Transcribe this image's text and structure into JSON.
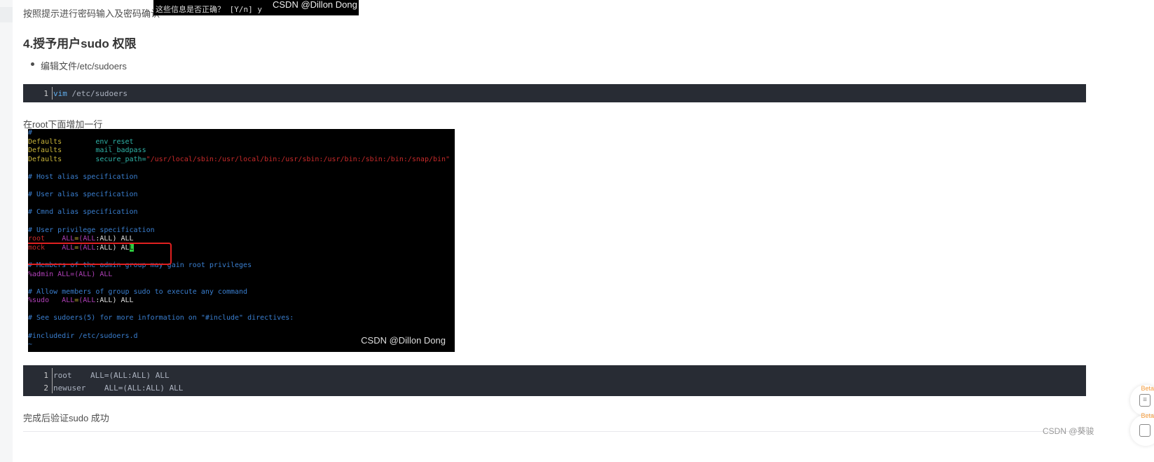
{
  "intro_text": "按照提示进行密码输入及密码确认",
  "top_image": {
    "line1": "这些信息是否正确？ [Y/n] y",
    "watermark": "CSDN @Dillon Dong"
  },
  "heading": "4.授予用户sudo 权限",
  "bullet": "编辑文件/etc/sudoers",
  "code1": {
    "lines": [
      {
        "n": "1",
        "kw": "vim",
        "rest": " /etc/sudoers"
      }
    ]
  },
  "para_root": "在root下面增加一行",
  "terminal": {
    "watermark": "CSDN @Dillon Dong",
    "hash": "#",
    "d1": [
      "Defaults",
      "env_reset"
    ],
    "d2": [
      "Defaults",
      "mail_badpass"
    ],
    "d3": [
      "Defaults",
      "secure_path=",
      "\"/usr/local/sbin:/usr/local/bin:/usr/sbin:/usr/bin:/sbin:/bin:/snap/bin\""
    ],
    "c_host": "# Host alias specification",
    "c_user": "# User alias specification",
    "c_cmnd": "# Cmnd alias specification",
    "c_priv": "# User privilege specification",
    "root_user": "root",
    "mock_user": "mock",
    "priv_a": "ALL",
    "priv_b": "=(",
    "priv_c": "ALL",
    ":ALL) ALL": ":ALL) ALL",
    "mock_tail": ":ALL) AL",
    "cursor": "L",
    "c_admin": "# Members of the admin group may gain root privileges",
    "admin_line": "%admin ALL=(ALL) ALL",
    "c_sudo": "# Allow members of group sudo to execute any command",
    "sudo_user": "%sudo",
    "c_see": "# See sudoers(5) for more information on \"#include\" directives:",
    "include": "#includedir /etc/sudoers.d",
    "tilde": "~"
  },
  "code2": {
    "lines": [
      {
        "n": "1",
        "text": "root    ALL=(ALL:ALL) ALL"
      },
      {
        "n": "2",
        "text": "newuser    ALL=(ALL:ALL) ALL"
      }
    ]
  },
  "final_text": "完成后验证sudo 成功",
  "sidebar": {
    "beta1": "Beta",
    "beta2": "Beta",
    "icon1": "list-icon",
    "icon2": "layout-icon"
  },
  "page_watermark": "CSDN @葵骏",
  "colors": {
    "code_bg": "#282c34",
    "highlight_box": "#e02020",
    "beta": "#f39a3a"
  }
}
